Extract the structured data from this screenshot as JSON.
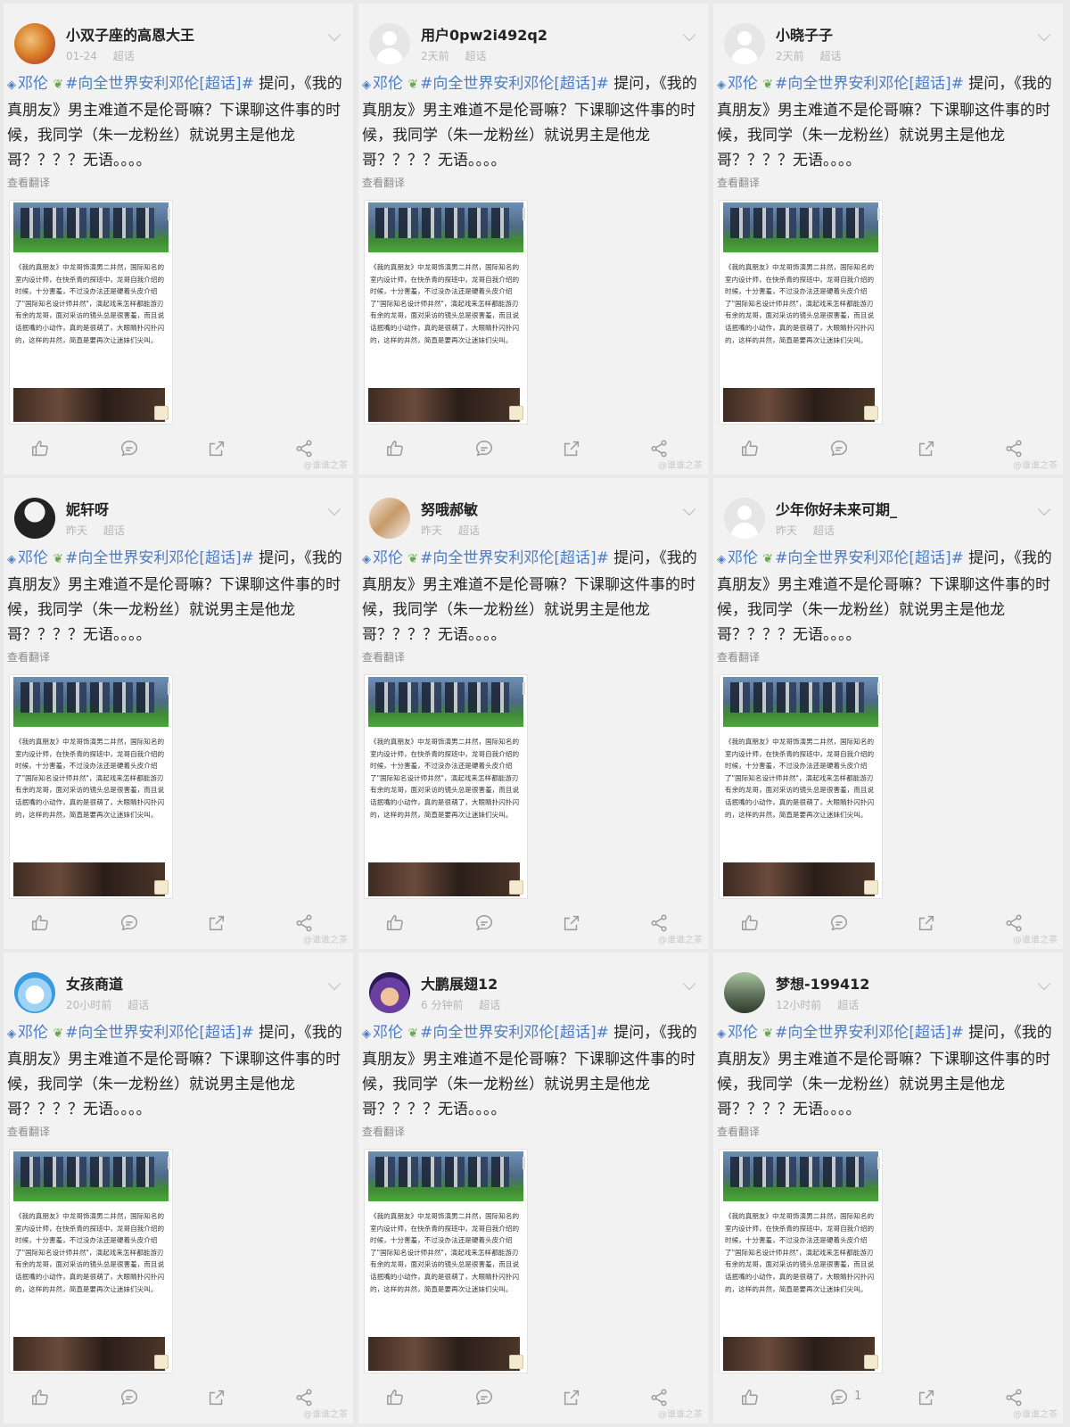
{
  "common": {
    "gem_icon": "◈",
    "leaf_icon": "❦",
    "tag_author": "邓伦",
    "tag_topic": "#向全世界安利邓伦[超话]#",
    "text_body": " 提问，《我的真朋友》男主难道不是伦哥嘛？下课聊这件事的时候，我同学（朱一龙粉丝）就说男主是他龙哥？？？？无语。。。。",
    "translate": "查看翻译",
    "article_text": "《我的真朋友》中龙哥饰演男二井然，国际知名的室内设计师，在快杀青的探班中，龙哥自我介绍的时候，十分害羞，不过没办法还是硬着头皮介绍了\"国际知名设计师井然\"，演起戏来怎样都能游刃有余的龙哥，面对采访的镜头总是很害羞，而且说话抿嘴的小动作，真的是很萌了，大眼睛扑闪扑闪的，这样的井然，简直是要再次让迷妹们尖叫。",
    "watermark": "@谁谁之茶"
  },
  "posts": [
    {
      "username": "小双子座的高恩大王",
      "time": "01-24",
      "source": "超话",
      "avatar": "photo-avatar",
      "comment_count": ""
    },
    {
      "username": "用户0pw2i492q2",
      "time": "2天前",
      "source": "超话",
      "avatar": "default-avatar",
      "comment_count": ""
    },
    {
      "username": "小晓子子",
      "time": "2天前",
      "source": "超话",
      "avatar": "default-avatar",
      "comment_count": ""
    },
    {
      "username": "妮轩呀",
      "time": "昨天",
      "source": "超话",
      "avatar": "photo-avatar",
      "comment_count": ""
    },
    {
      "username": "努哦郝敏",
      "time": "昨天",
      "source": "超话",
      "avatar": "photo-avatar",
      "comment_count": ""
    },
    {
      "username": "少年你好未来可期_",
      "time": "昨天",
      "source": "超话",
      "avatar": "default-avatar",
      "comment_count": ""
    },
    {
      "username": "女孩商道",
      "time": "20小时前",
      "source": "超话",
      "avatar": "photo-avatar",
      "comment_count": ""
    },
    {
      "username": "大鹏展翅12",
      "time": "6 分钟前",
      "source": "超话",
      "avatar": "photo-avatar",
      "comment_count": ""
    },
    {
      "username": "梦想-199412",
      "time": "12小时前",
      "source": "超话",
      "avatar": "photo-avatar",
      "comment_count": "1"
    }
  ],
  "colors": {
    "link": "#4a7cc7",
    "background": "#e9e9e9",
    "card": "#f2f2f2"
  }
}
